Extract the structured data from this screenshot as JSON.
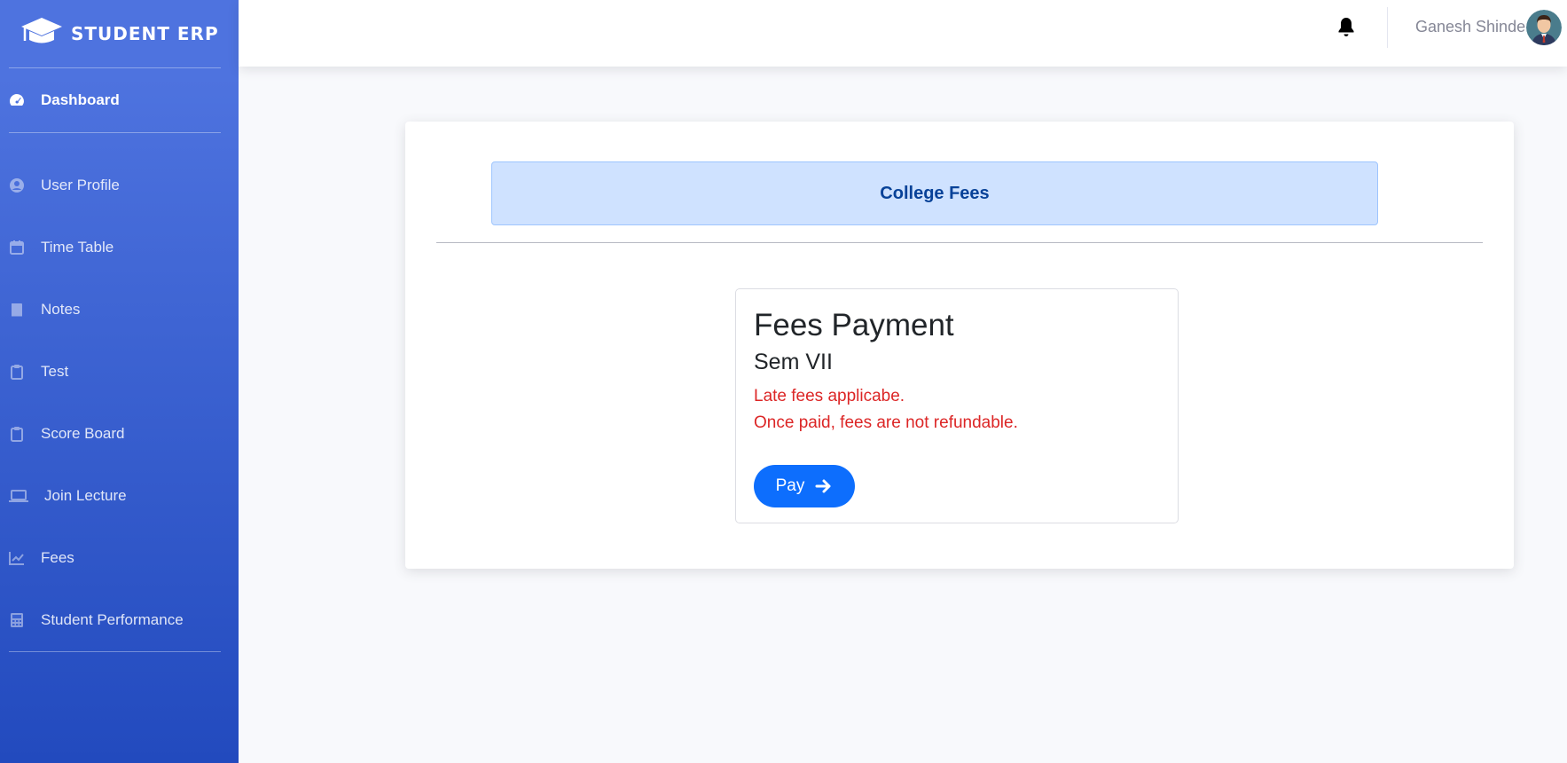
{
  "brand": {
    "name": "STUDENT ERP",
    "icon": "graduation-cap-icon"
  },
  "sidebar": {
    "items": [
      {
        "label": "Dashboard",
        "icon": "tachometer-icon"
      },
      {
        "label": "User Profile",
        "icon": "user-circle-icon"
      },
      {
        "label": "Time Table",
        "icon": "calendar-icon"
      },
      {
        "label": "Notes",
        "icon": "book-icon"
      },
      {
        "label": "Test",
        "icon": "clipboard-icon"
      },
      {
        "label": "Score Board",
        "icon": "clipboard-icon"
      },
      {
        "label": "Join Lecture",
        "icon": "laptop-icon"
      },
      {
        "label": "Fees",
        "icon": "chart-line-icon"
      },
      {
        "label": "Student Performance",
        "icon": "calculator-icon"
      }
    ]
  },
  "topbar": {
    "user_name": "Ganesh Shinde",
    "bell_icon": "bell-icon"
  },
  "main": {
    "alert_title": "College Fees",
    "fee_card": {
      "title": "Fees Payment",
      "semester": "Sem VII",
      "note_1": "Late fees applicabe.",
      "note_2": "Once paid, fees are not refundable.",
      "pay_label": "Pay"
    }
  },
  "colors": {
    "sidebar_top": "#4e73df",
    "sidebar_bottom": "#224abe",
    "alert_bg": "#cfe2ff",
    "alert_text": "#084298",
    "note_red": "#dc2626",
    "primary": "#0d6efd"
  }
}
